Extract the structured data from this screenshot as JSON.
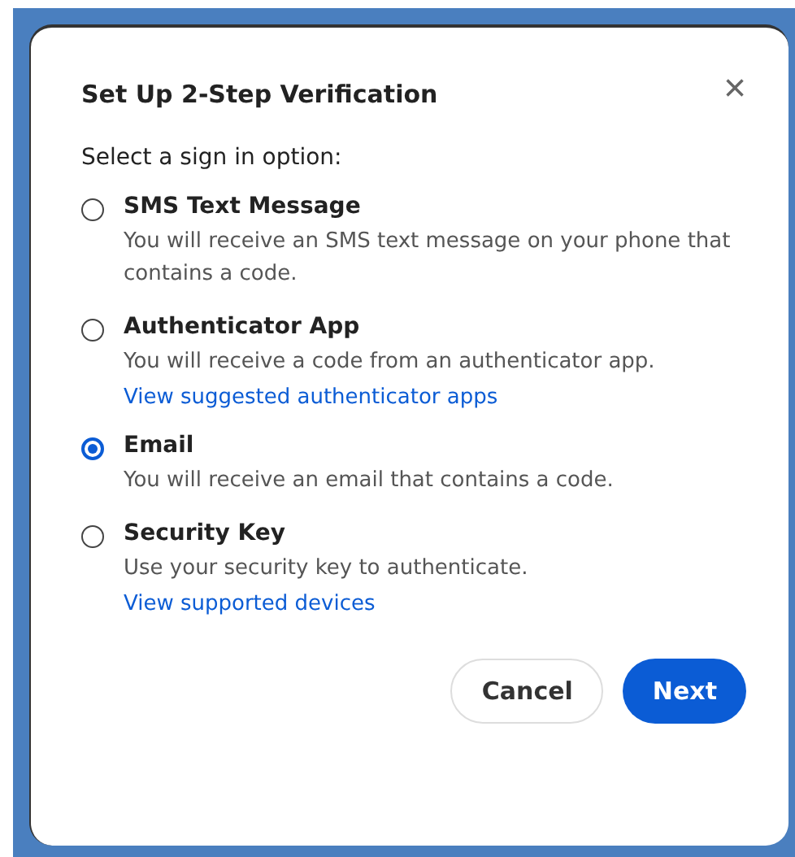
{
  "dialog": {
    "title": "Set Up 2-Step Verification",
    "close": "×",
    "prompt": "Select a sign in option:",
    "options": [
      {
        "label": "SMS Text Message",
        "selected": false,
        "description": "You will receive an SMS text message on your phone that contains a code."
      },
      {
        "label": "Authenticator App",
        "selected": false,
        "description": "You will receive a code from an authenticator app.",
        "link": "View suggested authenticator apps"
      },
      {
        "label": "Email",
        "selected": true,
        "description": "You will receive an email that contains a code."
      },
      {
        "label": "Security Key",
        "selected": false,
        "description": "Use your security key to authenticate.",
        "link": "View supported devices"
      }
    ],
    "buttons": [
      {
        "label": "Cancel",
        "kind": "secondary"
      },
      {
        "label": "Next",
        "kind": "primary"
      }
    ]
  }
}
